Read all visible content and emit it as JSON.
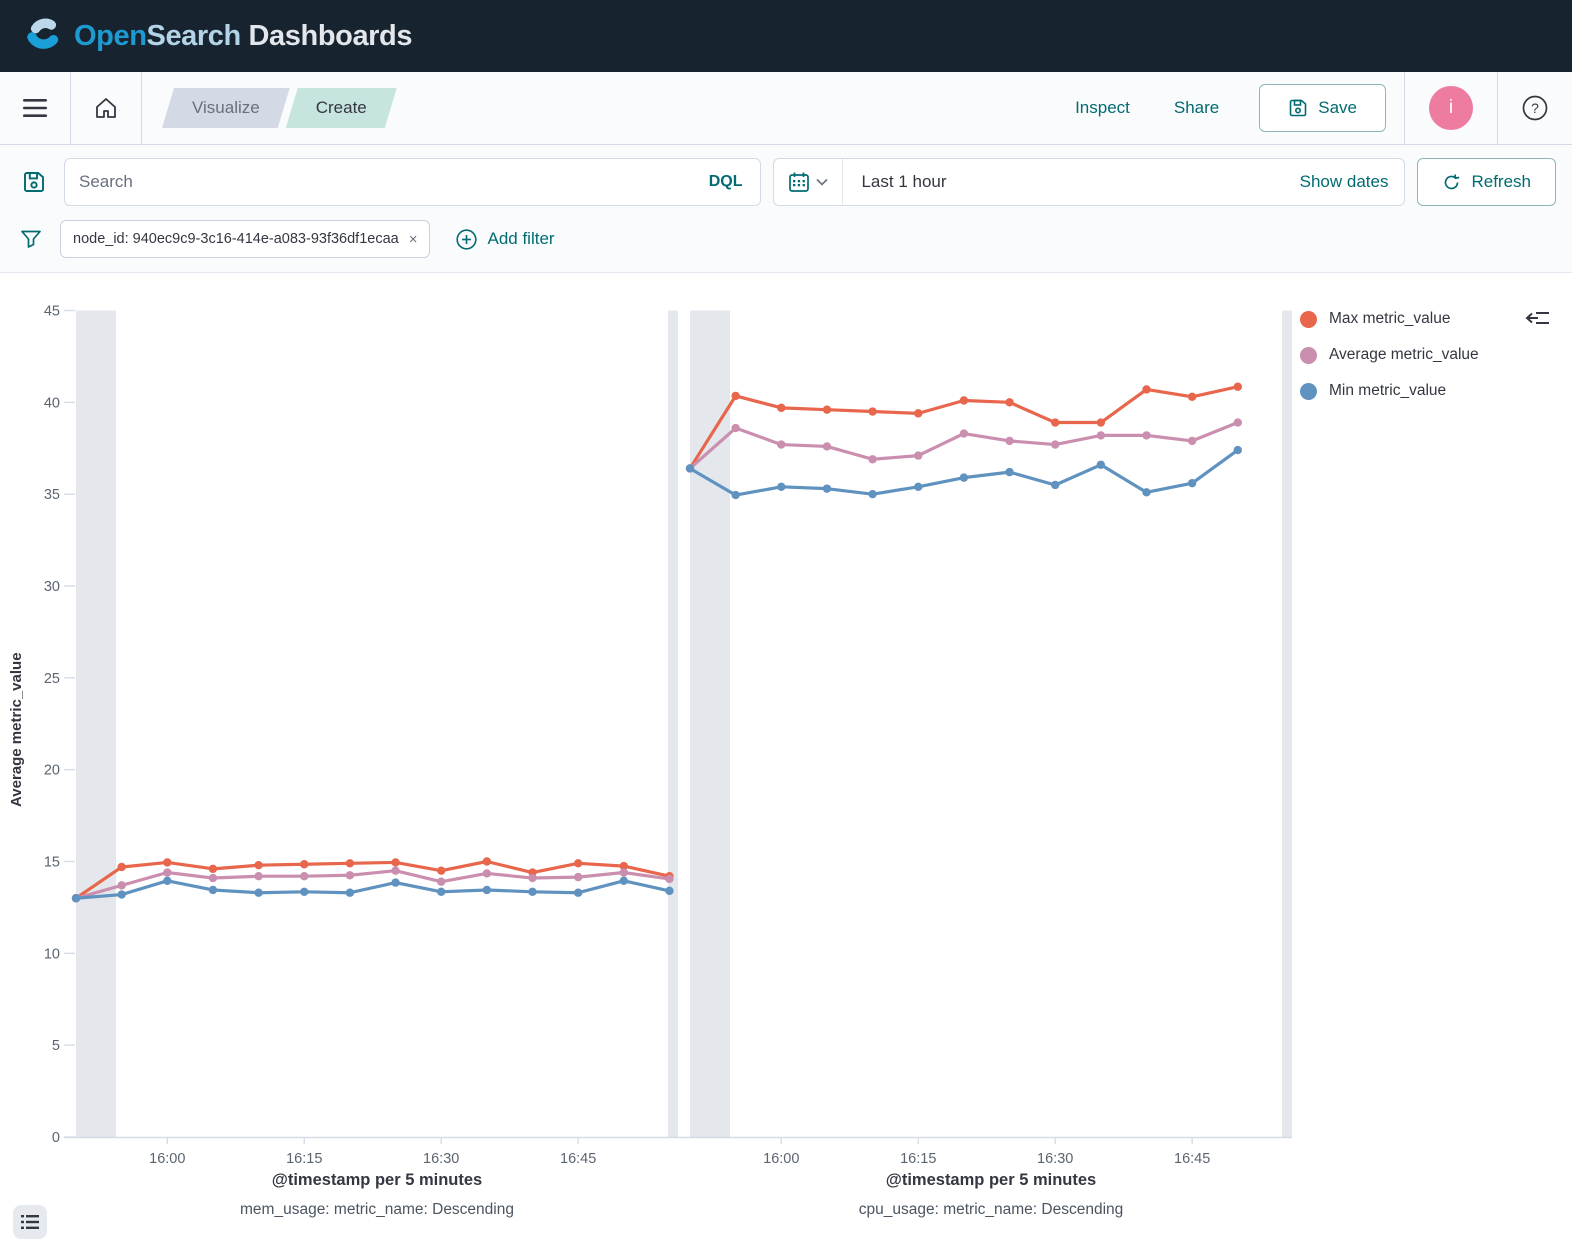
{
  "topbar": {
    "brand_open": "Open",
    "brand_search": "Search",
    "brand_rest": " Dashboards"
  },
  "navbar": {
    "breadcrumbs": [
      {
        "label": "Visualize"
      },
      {
        "label": "Create"
      }
    ],
    "inspect_label": "Inspect",
    "share_label": "Share",
    "save_label": "Save",
    "avatar_initial": "i",
    "help_glyph": "?"
  },
  "query_bar": {
    "search_placeholder": "Search",
    "language_label": "DQL",
    "time_range": "Last 1 hour",
    "show_dates_label": "Show dates",
    "refresh_label": "Refresh"
  },
  "filter_bar": {
    "filter_pill": "node_id: 940ec9c9-3c16-414e-a083-93f36df1ecaa",
    "remove_glyph": "×",
    "add_filter_label": "Add filter"
  },
  "colors": {
    "max_series": "#e7664c",
    "avg_series": "#ca8eae",
    "min_series": "#6092c0",
    "accent_teal": "#016b71",
    "avatar_pink": "#ee7ba0",
    "partial_band": "#e4e7ec",
    "topbar_bg": "#172430"
  },
  "legend": {
    "items": [
      {
        "label": "Max metric_value",
        "color": "#e7664c"
      },
      {
        "label": "Average metric_value",
        "color": "#ca8eae"
      },
      {
        "label": "Min metric_value",
        "color": "#6092c0"
      }
    ]
  },
  "axes": {
    "y_title": "Average metric_value"
  },
  "chart_data": [
    {
      "type": "line",
      "xlabel": "@timestamp per 5 minutes",
      "sublabel": "mem_usage: metric_name: Descending",
      "ylabel": "Average metric_value",
      "ylim": [
        0,
        45
      ],
      "y_ticks": [
        0,
        5,
        10,
        15,
        20,
        25,
        30,
        35,
        40,
        45
      ],
      "show_y_axis": true,
      "x": [
        "15:50",
        "15:55",
        "16:00",
        "16:05",
        "16:10",
        "16:15",
        "16:20",
        "16:25",
        "16:30",
        "16:35",
        "16:40",
        "16:45",
        "16:50",
        "16:55"
      ],
      "x_tick_indices": [
        2,
        5,
        8,
        11
      ],
      "x_tick_labels": [
        "16:00",
        "16:15",
        "16:30",
        "16:45"
      ],
      "legend_position": "right",
      "grid": false,
      "series": [
        {
          "name": "Max metric_value",
          "color": "#e7664c",
          "values": [
            13.0,
            14.7,
            14.95,
            14.6,
            14.8,
            14.85,
            14.9,
            14.95,
            14.5,
            15.0,
            14.4,
            14.9,
            14.75,
            14.2
          ]
        },
        {
          "name": "Average metric_value",
          "color": "#ca8eae",
          "values": [
            13.0,
            13.7,
            14.4,
            14.1,
            14.2,
            14.2,
            14.25,
            14.5,
            13.9,
            14.35,
            14.1,
            14.15,
            14.4,
            14.05
          ]
        },
        {
          "name": "Min metric_value",
          "color": "#6092c0",
          "values": [
            13.0,
            13.2,
            13.95,
            13.45,
            13.3,
            13.35,
            13.3,
            13.85,
            13.35,
            13.45,
            13.35,
            13.3,
            13.95,
            13.4
          ]
        }
      ]
    },
    {
      "type": "line",
      "xlabel": "@timestamp per 5 minutes",
      "sublabel": "cpu_usage: metric_name: Descending",
      "ylabel": "Average metric_value",
      "ylim": [
        0,
        45
      ],
      "y_ticks": [
        0,
        5,
        10,
        15,
        20,
        25,
        30,
        35,
        40,
        45
      ],
      "show_y_axis": false,
      "x": [
        "15:50",
        "15:55",
        "16:00",
        "16:05",
        "16:10",
        "16:15",
        "16:20",
        "16:25",
        "16:30",
        "16:35",
        "16:40",
        "16:45",
        "16:50"
      ],
      "x_tick_indices": [
        2,
        5,
        8,
        11
      ],
      "x_tick_labels": [
        "16:00",
        "16:15",
        "16:30",
        "16:45"
      ],
      "legend_position": "right",
      "grid": false,
      "series": [
        {
          "name": "Max metric_value",
          "color": "#e7664c",
          "values": [
            36.4,
            40.35,
            39.7,
            39.6,
            39.5,
            39.4,
            40.1,
            40.0,
            38.9,
            38.9,
            40.7,
            40.3,
            40.85
          ]
        },
        {
          "name": "Average metric_value",
          "color": "#ca8eae",
          "values": [
            36.4,
            38.6,
            37.7,
            37.6,
            36.9,
            37.1,
            38.3,
            37.9,
            37.7,
            38.2,
            38.2,
            37.9,
            38.9
          ]
        },
        {
          "name": "Min metric_value",
          "color": "#6092c0",
          "values": [
            36.4,
            34.95,
            35.4,
            35.3,
            35.0,
            35.4,
            35.9,
            36.2,
            35.5,
            36.6,
            35.1,
            35.6,
            37.4
          ]
        }
      ]
    }
  ]
}
